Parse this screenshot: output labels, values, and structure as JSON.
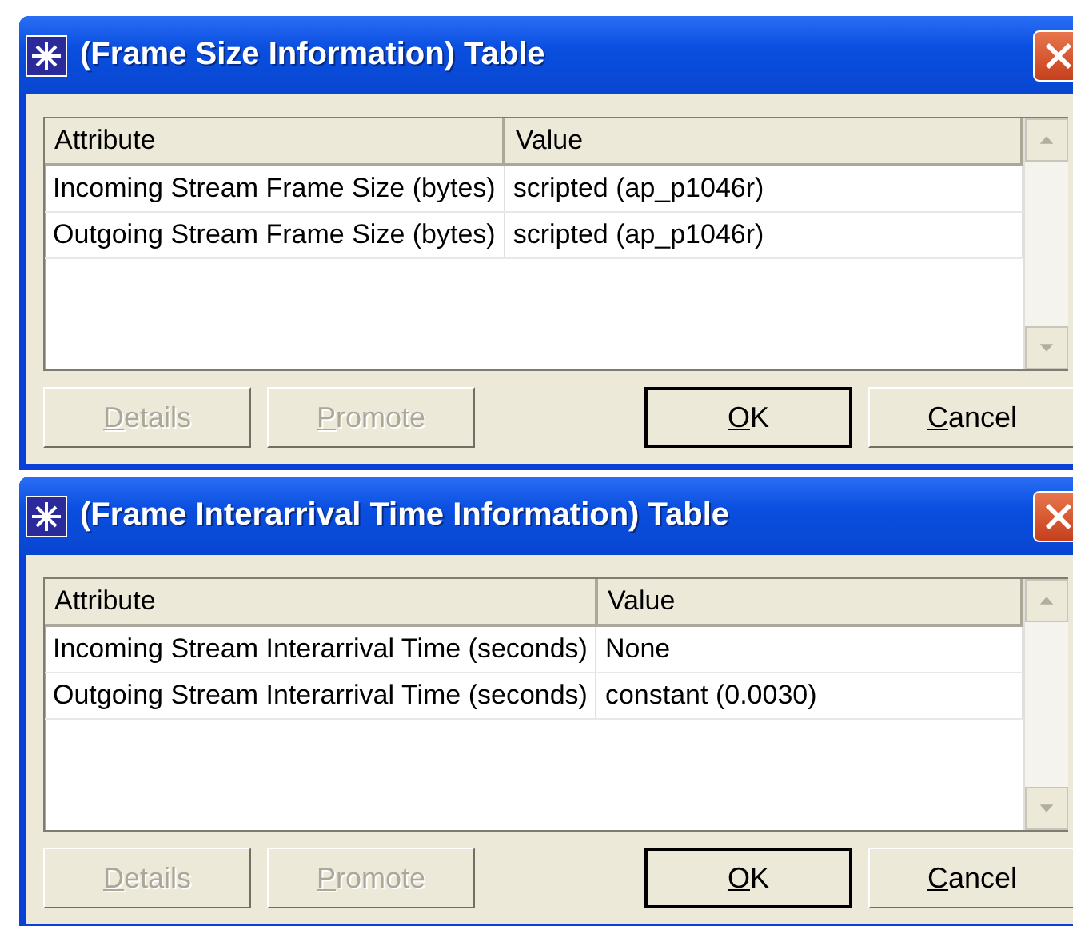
{
  "dialogs": [
    {
      "title": "(Frame Size Information) Table",
      "columns": [
        "Attribute",
        "Value"
      ],
      "rows": [
        [
          "Incoming Stream Frame Size (bytes)",
          "scripted (ap_p1046r)"
        ],
        [
          "Outgoing Stream Frame Size (bytes)",
          "scripted (ap_p1046r)"
        ]
      ],
      "buttons": [
        {
          "label": "Details",
          "disabled": true,
          "default": false
        },
        {
          "label": "Promote",
          "disabled": true,
          "default": false
        },
        {
          "label": "OK",
          "disabled": false,
          "default": true
        },
        {
          "label": "Cancel",
          "disabled": false,
          "default": false
        }
      ]
    },
    {
      "title": "(Frame Interarrival Time Information) Table",
      "columns": [
        "Attribute",
        "Value"
      ],
      "rows": [
        [
          "Incoming Stream Interarrival Time (seconds)",
          "None"
        ],
        [
          "Outgoing Stream Interarrival Time (seconds)",
          "constant (0.0030)"
        ]
      ],
      "buttons": [
        {
          "label": "Details",
          "disabled": true,
          "default": false
        },
        {
          "label": "Promote",
          "disabled": true,
          "default": false
        },
        {
          "label": "OK",
          "disabled": false,
          "default": true
        },
        {
          "label": "Cancel",
          "disabled": false,
          "default": false
        }
      ]
    }
  ]
}
